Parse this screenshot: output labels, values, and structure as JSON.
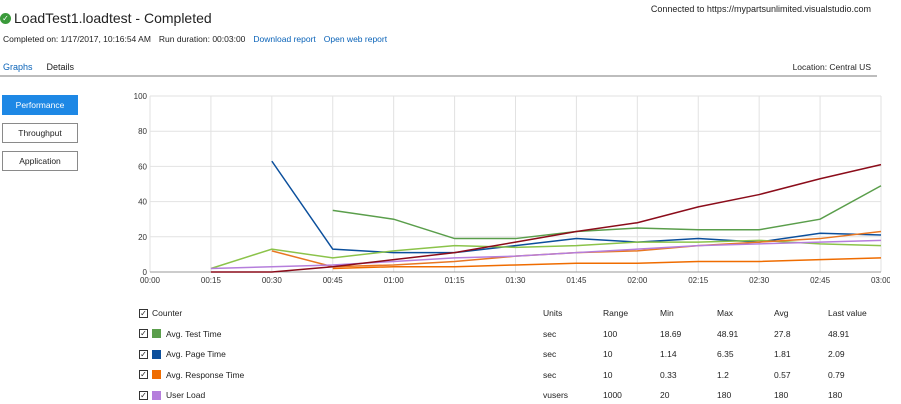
{
  "header": {
    "status_icon": "check-circle-icon",
    "title": "LoadTest1.loadtest - Completed",
    "connected": "Connected to https://mypartsunlimited.visualstudio.com",
    "completed_on": "Completed on: 1/17/2017, 10:16:54 AM",
    "run_duration": "Run duration: 00:03:00",
    "download_report": "Download report",
    "open_web_report": "Open web report"
  },
  "tabs": [
    {
      "label": "Graphs",
      "active": true
    },
    {
      "label": "Details",
      "active": false
    }
  ],
  "location": "Location: Central US",
  "sidebar": [
    {
      "label": "Performance",
      "active": true
    },
    {
      "label": "Throughput",
      "active": false
    },
    {
      "label": "Application",
      "active": false
    }
  ],
  "chart_data": {
    "type": "line",
    "x": [
      "00:00",
      "00:15",
      "00:30",
      "00:45",
      "01:00",
      "01:15",
      "01:30",
      "01:45",
      "02:00",
      "02:15",
      "02:30",
      "02:45",
      "03:00"
    ],
    "ylim": [
      0,
      100
    ],
    "yticks": [
      0,
      20,
      40,
      60,
      80,
      100
    ],
    "grid": true,
    "series": [
      {
        "color": "#5a9e4b",
        "values": [
          null,
          null,
          null,
          35,
          30,
          19,
          19,
          23,
          25,
          24,
          24,
          30,
          49
        ]
      },
      {
        "color": "#0b4f9c",
        "values": [
          null,
          null,
          63,
          13,
          11,
          11,
          15,
          19,
          17,
          19,
          17,
          22,
          21
        ]
      },
      {
        "color": "#8bc34a",
        "values": [
          null,
          2,
          13,
          8,
          12,
          15,
          14,
          15,
          17,
          17,
          18,
          16,
          15
        ]
      },
      {
        "color": "#e87722",
        "values": [
          null,
          null,
          12,
          3,
          4,
          6,
          9,
          11,
          12,
          15,
          17,
          19,
          23
        ]
      },
      {
        "color": "#ef6c00",
        "values": [
          null,
          null,
          null,
          2,
          3,
          3,
          4,
          5,
          5,
          6,
          6,
          7,
          8
        ]
      },
      {
        "color": "#b57edc",
        "values": [
          null,
          2,
          3,
          4,
          6,
          8,
          9,
          11,
          13,
          15,
          16,
          17,
          18
        ]
      },
      {
        "color": "#8b0c1a",
        "values": [
          null,
          0,
          0,
          3,
          7,
          11,
          17,
          23,
          28,
          37,
          44,
          53,
          61
        ]
      }
    ]
  },
  "table": {
    "headers": {
      "counter": "Counter",
      "units": "Units",
      "range": "Range",
      "min": "Min",
      "max": "Max",
      "avg": "Avg",
      "last": "Last value"
    },
    "rows": [
      {
        "name": "Avg. Test Time",
        "color": "#5a9e4b",
        "units": "sec",
        "range": "100",
        "min": "18.69",
        "max": "48.91",
        "avg": "27.8",
        "last": "48.91"
      },
      {
        "name": "Avg. Page Time",
        "color": "#0b4f9c",
        "units": "sec",
        "range": "10",
        "min": "1.14",
        "max": "6.35",
        "avg": "1.81",
        "last": "2.09"
      },
      {
        "name": "Avg. Response Time",
        "color": "#ef6c00",
        "units": "sec",
        "range": "10",
        "min": "0.33",
        "max": "1.2",
        "avg": "0.57",
        "last": "0.79"
      },
      {
        "name": "User Load",
        "color": "#b57edc",
        "units": "vusers",
        "range": "1000",
        "min": "20",
        "max": "180",
        "avg": "180",
        "last": "180"
      }
    ]
  }
}
